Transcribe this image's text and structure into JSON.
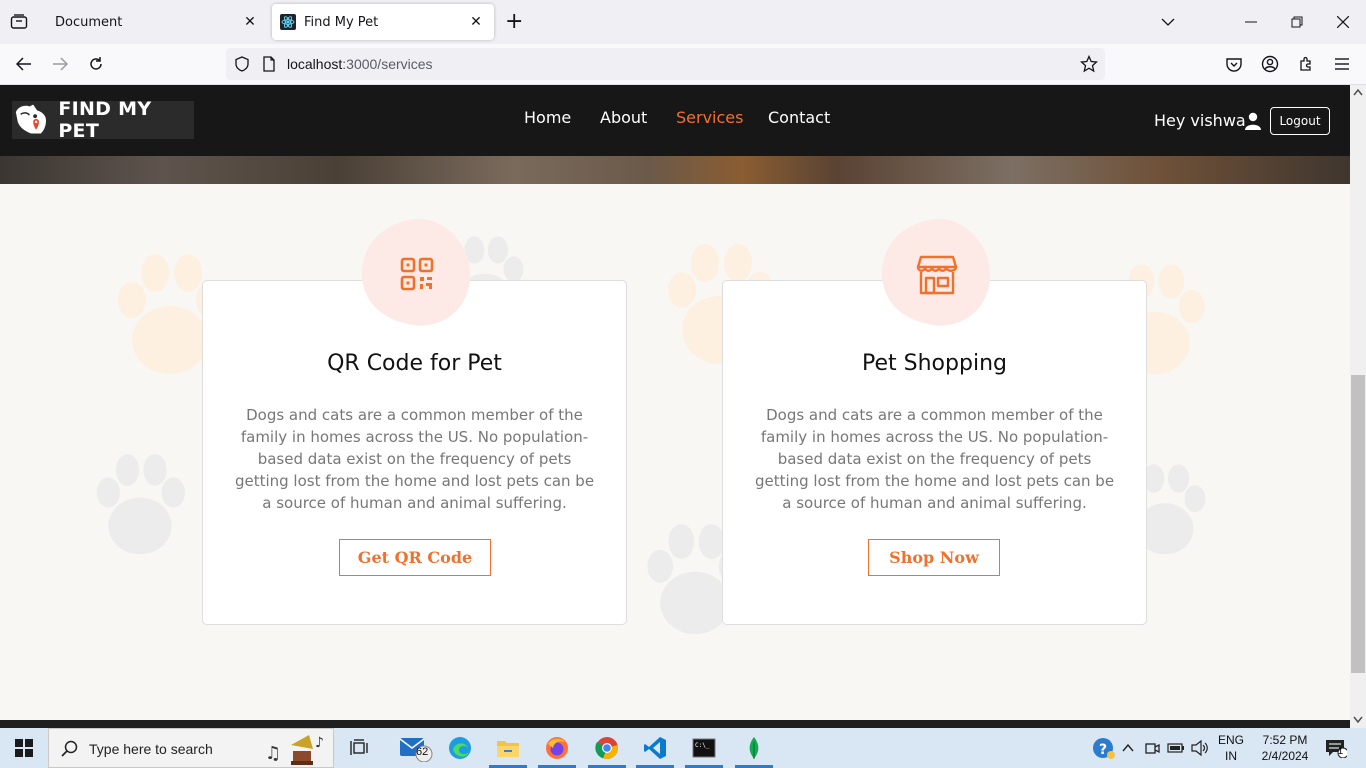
{
  "browser": {
    "tabs": [
      {
        "title": "Document",
        "active": false
      },
      {
        "title": "Find My Pet",
        "active": true
      }
    ],
    "url_host": "localhost",
    "url_rest": ":3000/services"
  },
  "site": {
    "logo_text": "FIND MY PET",
    "menu": [
      {
        "label": "Home",
        "active": false
      },
      {
        "label": "About",
        "active": false
      },
      {
        "label": "Services",
        "active": true
      },
      {
        "label": "Contact",
        "active": false
      }
    ],
    "greeting": "Hey vishwa",
    "logout_label": "Logout",
    "accent_color": "#f0712c"
  },
  "services": [
    {
      "icon": "qr-code-icon",
      "title": "QR Code for Pet",
      "description": "Dogs and cats are a common member of the family in homes across the US. No population-based data exist on the frequency of pets getting lost from the home and lost pets can be a source of human and animal suffering.",
      "button_label": "Get QR Code"
    },
    {
      "icon": "store-icon",
      "title": "Pet Shopping",
      "description": "Dogs and cats are a common member of the family in homes across the US. No population-based data exist on the frequency of pets getting lost from the home and lost pets can be a source of human and animal suffering.",
      "button_label": "Shop Now"
    }
  ],
  "taskbar": {
    "search_placeholder": "Type here to search",
    "mail_badge": "62",
    "language_line1": "ENG",
    "language_line2": "IN",
    "time": "7:52 PM",
    "date": "2/4/2024",
    "notification_count": "1"
  }
}
